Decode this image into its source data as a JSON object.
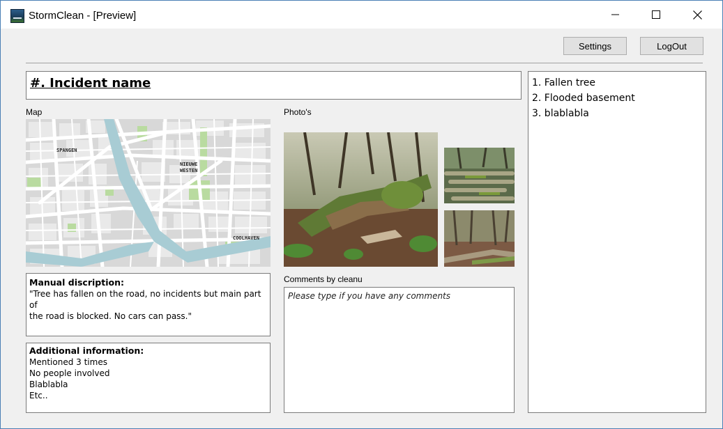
{
  "window": {
    "title": "StormClean - [Preview]",
    "app_icon": "app-logo-icon",
    "controls": [
      "minimize-icon",
      "maximize-icon",
      "close-icon"
    ]
  },
  "toolbar": {
    "settings_label": "Settings",
    "logout_label": "LogOut"
  },
  "incident": {
    "title": "#. Incident name"
  },
  "map": {
    "label": "Map",
    "places": [
      "SPANGEN",
      "NIEUWE",
      "WESTEN",
      "COOLHAVEN"
    ]
  },
  "photos": {
    "label": "Photo's"
  },
  "comments": {
    "label": "Comments by cleanu",
    "placeholder": "Please type if you have any comments"
  },
  "description": {
    "heading": "Manual discription:",
    "text_line1": "\"Tree has fallen on the road, no incidents but main part of",
    "text_line2": "the road is blocked. No cars can pass.\""
  },
  "additional": {
    "heading": "Additional information:",
    "lines": [
      "Mentioned 3 times",
      "No people involved",
      "Blablabla",
      "Etc.."
    ]
  },
  "incident_list": {
    "items": [
      "1. Fallen tree",
      "2. Flooded basement",
      "3. blablabla"
    ]
  },
  "colors": {
    "window_border": "#4a7fb5",
    "background": "#f0f0f0",
    "button_bg": "#e1e1e1",
    "map_water": "#a8ccd4",
    "map_park": "#b9dba0"
  }
}
